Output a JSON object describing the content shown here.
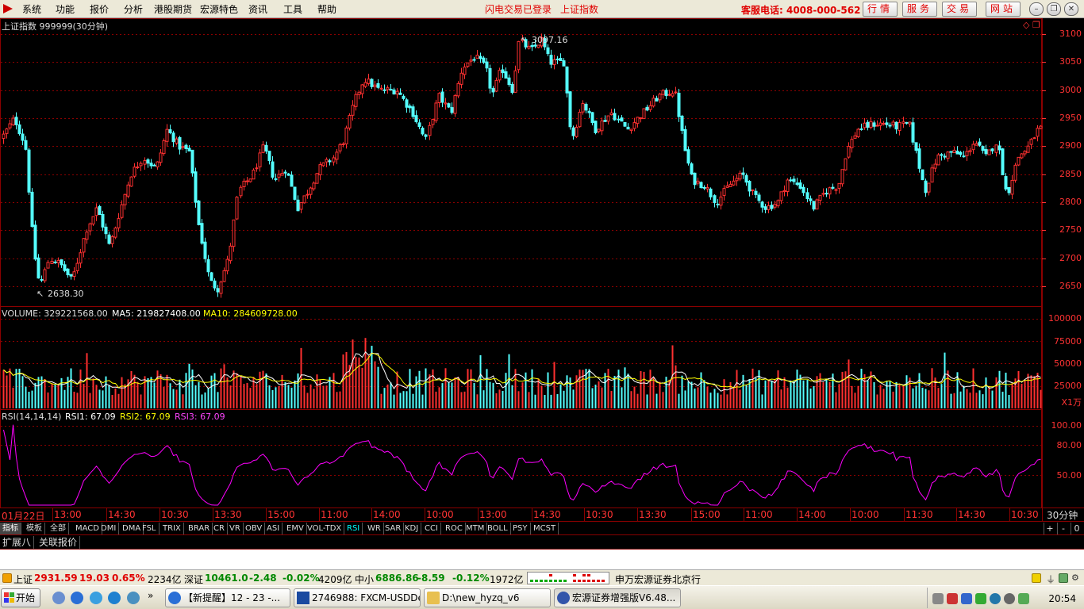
{
  "menubar": {
    "items": [
      "系统",
      "功能",
      "报价",
      "分析",
      "港股期货",
      "宏源特色",
      "资讯",
      "工具",
      "帮助"
    ],
    "login_status": "闪电交易已登录",
    "current_index": "上证指数",
    "hotline": "客服电话: 4008-000-562",
    "nav_buttons": [
      "行情",
      "服务",
      "交易",
      "网站"
    ]
  },
  "chart": {
    "title": "上证指数 999999(30分钟)",
    "high_label": "3097.16",
    "low_label": "2638.30",
    "price_axis": [
      "3100",
      "3050",
      "3000",
      "2950",
      "2900",
      "2850",
      "2800",
      "2750",
      "2700",
      "2650"
    ],
    "volume_header": {
      "label": "VOLUME: 329221568.00",
      "ma5": "MA5: 219827408.00",
      "ma10": "MA10: 284609728.00"
    },
    "volume_axis": [
      "100000",
      "75000",
      "50000",
      "25000"
    ],
    "volume_unit": "X1万",
    "rsi_header": {
      "label": "RSI(14,14,14)",
      "rsi1": "RSI1: 67.09",
      "rsi2": "RSI2: 67.09",
      "rsi3": "RSI3: 67.09"
    },
    "rsi_axis": [
      "100.00",
      "80.00",
      "50.00"
    ],
    "time_axis": [
      "01月22日",
      "13:00",
      "14:30",
      "10:30",
      "13:30",
      "15:00",
      "11:00",
      "14:00",
      "10:00",
      "13:00",
      "14:30",
      "10:30",
      "13:30",
      "15:00",
      "11:00",
      "14:00",
      "10:00",
      "11:30",
      "14:30",
      "10:30"
    ],
    "period": "30分钟",
    "colors": {
      "up": "#ff3030",
      "down": "#54ffff",
      "ma5": "#ffffff",
      "ma10": "#ffff00",
      "rsi": "#ff00ff",
      "grid": "#8b0000"
    }
  },
  "indicator_tabs": [
    "指标",
    "模板",
    "全部",
    "MACD",
    "DMI",
    "DMA",
    "FSL",
    "TRIX",
    "BRAR",
    "CR",
    "VR",
    "OBV",
    "ASI",
    "EMV",
    "VOL-TDX",
    "RSI",
    "WR",
    "SAR",
    "KDJ",
    "CCI",
    "ROC",
    "MTM",
    "BOLL",
    "PSY",
    "MCST"
  ],
  "selected_indicator": "RSI",
  "zoom_buttons": [
    "+",
    "-",
    "0"
  ],
  "ext_tabs": [
    "扩展八",
    "关联报价"
  ],
  "statusbar": {
    "sh_name": "上证",
    "sh_value": "2931.59",
    "sh_change": "19.03",
    "sh_pct": "0.65%",
    "sh_amount": "2234亿",
    "sz_name": "深证",
    "sz_value": "10461.0",
    "sz_change": "-2.48",
    "sz_pct": "-0.02%",
    "sz_amount": "4209亿",
    "zx_name": "中小",
    "zx_value": "6886.86",
    "zx_change": "-8.59",
    "zx_pct": "-0.12%",
    "zx_amount": "1972亿",
    "broker": "申万宏源证券北京行"
  },
  "taskbar": {
    "start": "开始",
    "tasks": [
      "【新提醒】12 - 23 -...",
      "2746988: FXCM-USDDe...",
      "D:\\new_hyzq_v6",
      "宏源证券增强版V6.48..."
    ],
    "clock": "20:54"
  }
}
